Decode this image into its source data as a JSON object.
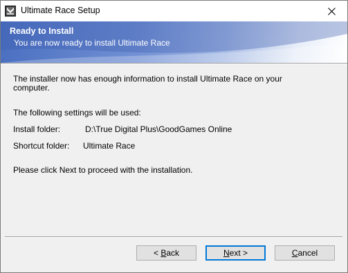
{
  "window": {
    "title": "Ultimate Race Setup",
    "close_glyph": "✕"
  },
  "banner": {
    "title": "Ready to Install",
    "subtitle": "You are now ready to install Ultimate Race"
  },
  "content": {
    "intro": "The installer now has enough information to install Ultimate Race on your computer.",
    "settings_heading": "The following settings will be used:",
    "install_folder_label": "Install folder:",
    "install_folder_value": "D:\\True Digital Plus\\GoodGames Online",
    "shortcut_folder_label": "Shortcut folder:",
    "shortcut_folder_value": "Ultimate Race",
    "proceed_text": "Please click Next to proceed with the installation."
  },
  "buttons": {
    "back_prefix": "< ",
    "back_mnemonic": "B",
    "back_rest": "ack",
    "next_mnemonic": "N",
    "next_rest": "ext >",
    "cancel_mnemonic": "C",
    "cancel_rest": "ancel"
  }
}
